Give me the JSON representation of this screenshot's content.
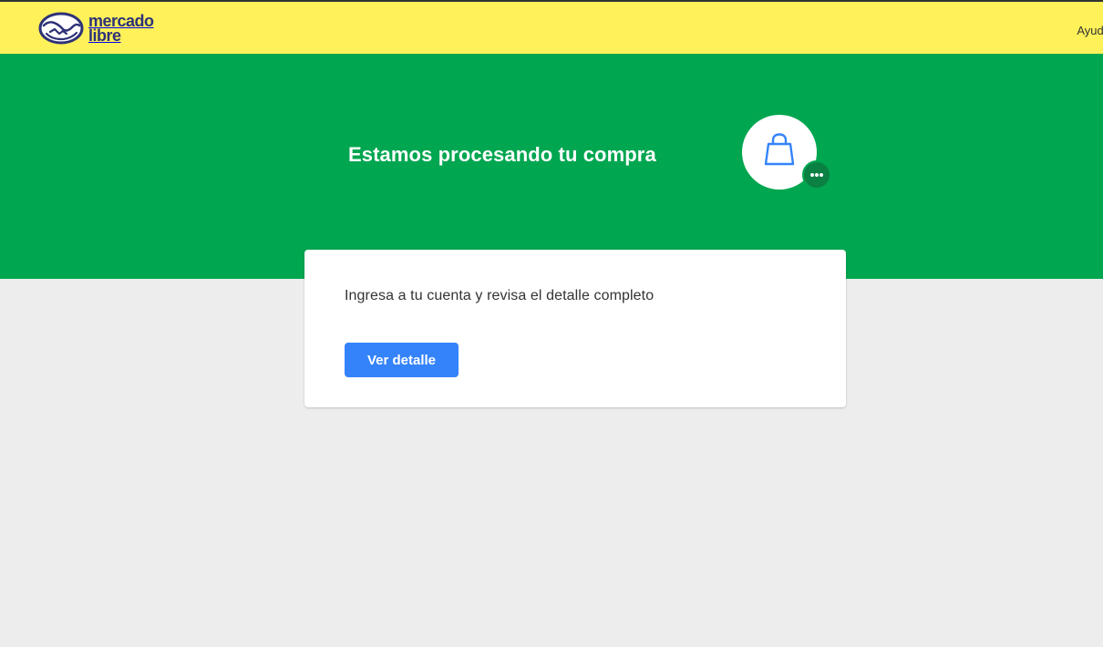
{
  "header": {
    "logo_line1": "mercado",
    "logo_line2": "libre",
    "logo_icon": "mercado-libre-handshake-logo",
    "help_label": "Ayuda"
  },
  "hero": {
    "title": "Estamos procesando tu compra",
    "icon": "shopping-bag-icon",
    "badge_icon": "more-dots-icon"
  },
  "card": {
    "message": "Ingresa a tu cuenta y revisa el detalle completo",
    "button_label": "Ver detalle"
  },
  "colors": {
    "header_bg": "#fff159",
    "hero_bg": "#00a650",
    "page_bg": "#ededed",
    "primary": "#3483fa",
    "logo_text": "#2d3277",
    "badge": "#0b8043"
  }
}
